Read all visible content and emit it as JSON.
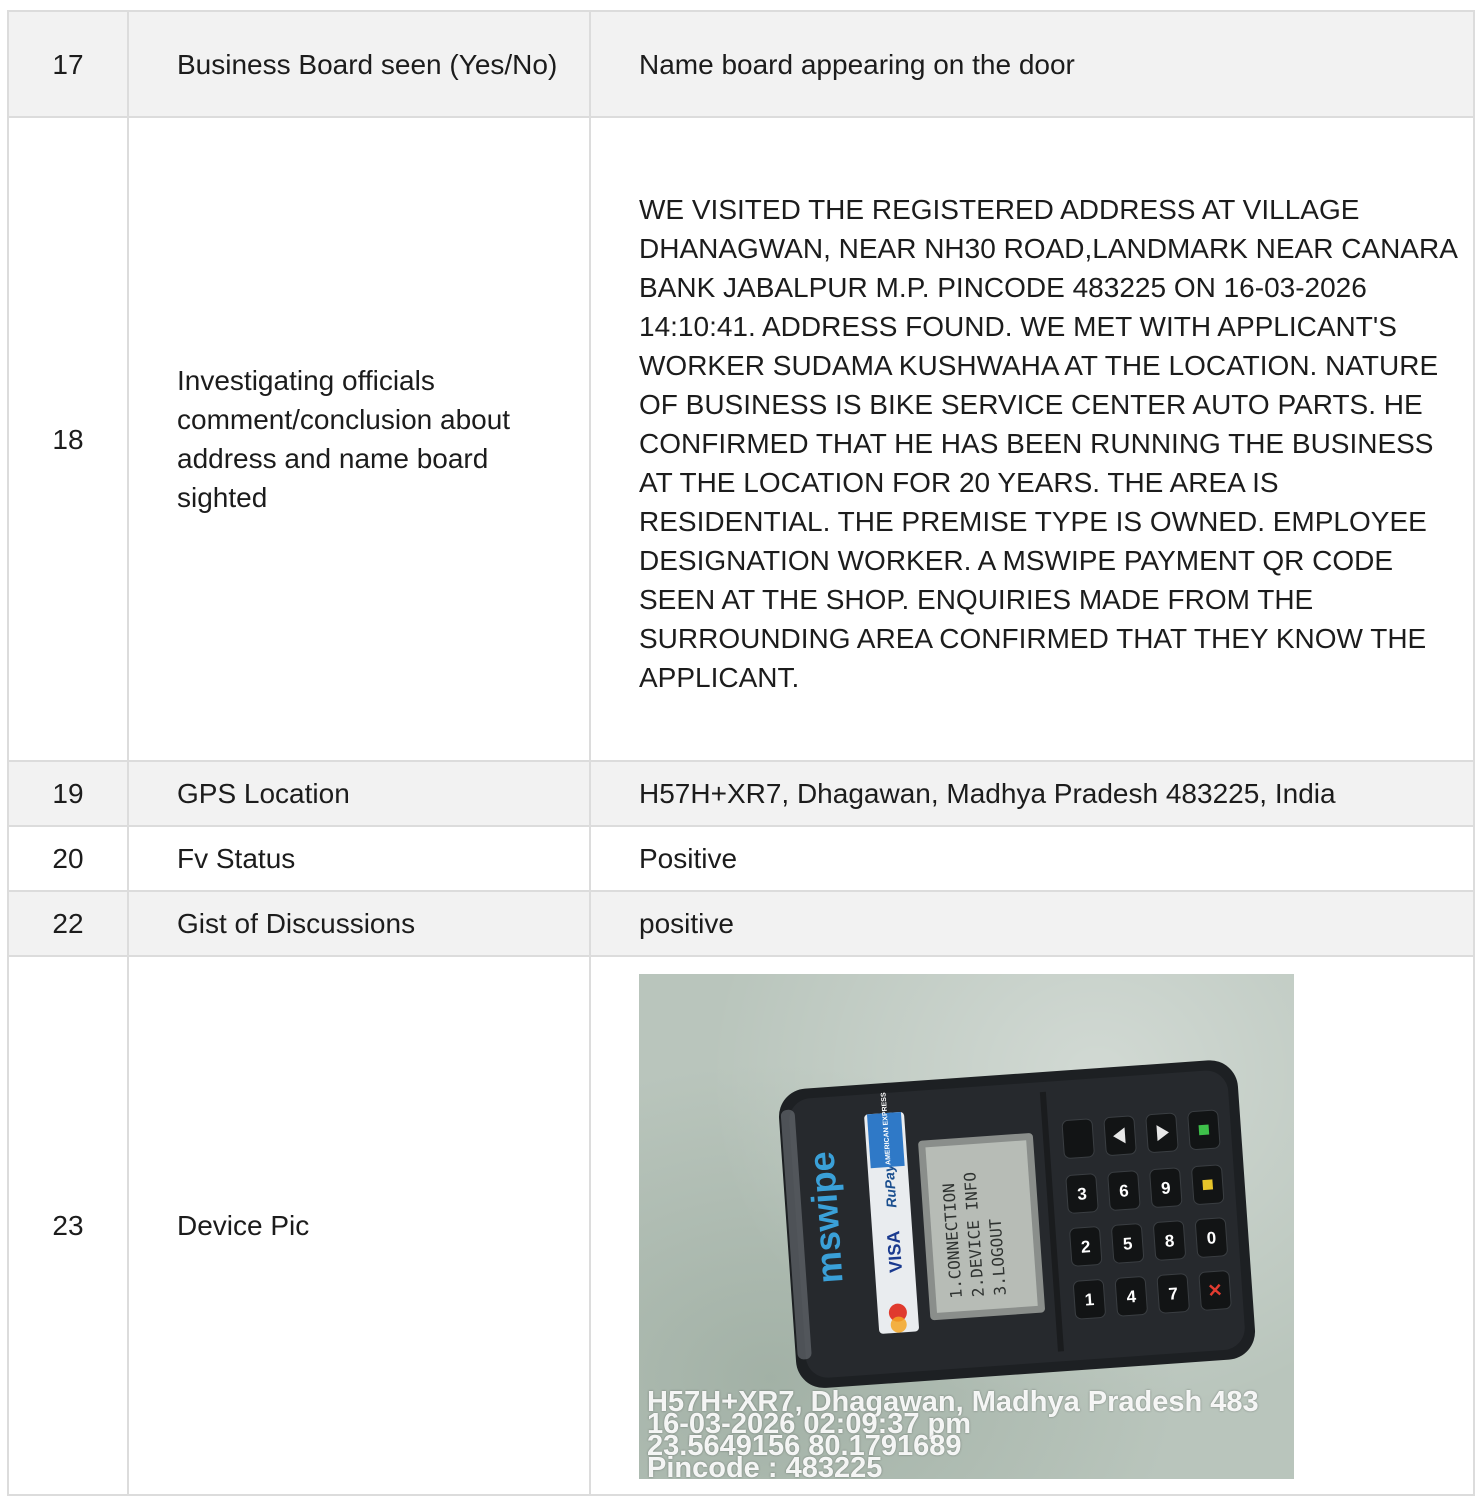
{
  "rows": [
    {
      "no": "17",
      "label": "Business Board seen (Yes/No)",
      "value": "Name board appearing on the door"
    },
    {
      "no": "18",
      "label": "Investigating officials comment/conclusion about address and name board sighted",
      "value": "WE VISITED THE REGISTERED ADDRESS AT VILLAGE DHANAGWAN, NEAR NH30 ROAD,LANDMARK NEAR CANARA BANK JABALPUR M.P. PINCODE 483225 ON 16-03-2026 14:10:41. ADDRESS FOUND. WE MET WITH APPLICANT'S WORKER SUDAMA KUSHWAHA AT THE LOCATION. NATURE OF BUSINESS IS BIKE SERVICE CENTER AUTO PARTS. HE CONFIRMED THAT HE HAS BEEN RUNNING THE BUSINESS AT THE LOCATION FOR 20 YEARS. THE AREA IS RESIDENTIAL. THE PREMISE TYPE IS OWNED. EMPLOYEE DESIGNATION WORKER. A MSWIPE PAYMENT QR CODE SEEN AT THE SHOP. ENQUIRIES MADE FROM THE SURROUNDING AREA CONFIRMED THAT THEY KNOW THE APPLICANT."
    },
    {
      "no": "19",
      "label": "GPS Location",
      "value": "H57H+XR7, Dhagawan, Madhya Pradesh 483225, India"
    },
    {
      "no": "20",
      "label": "Fv Status",
      "value": "Positive"
    },
    {
      "no": "22",
      "label": "Gist of Discussions",
      "value": "positive"
    },
    {
      "no": "23",
      "label": "Device Pic"
    }
  ],
  "device_photo": {
    "device_brand": "mswipe",
    "card_logos": [
      "VISA",
      "RuPay",
      "AMERICAN EXPRESS"
    ],
    "screen_lines": [
      "1.CONNECTION",
      "2.DEVICE INFO",
      "3.LOGOUT"
    ],
    "keys": [
      "1",
      "2",
      "3",
      "4",
      "5",
      "6",
      "7",
      "8",
      "9",
      "0"
    ],
    "stamp_lines": [
      "H57H+XR7, Dhagawan, Madhya Pradesh 483",
      "16-03-2026 02:09:37 pm",
      "23.5649156 80.1791689",
      "Pincode : 483225"
    ]
  }
}
